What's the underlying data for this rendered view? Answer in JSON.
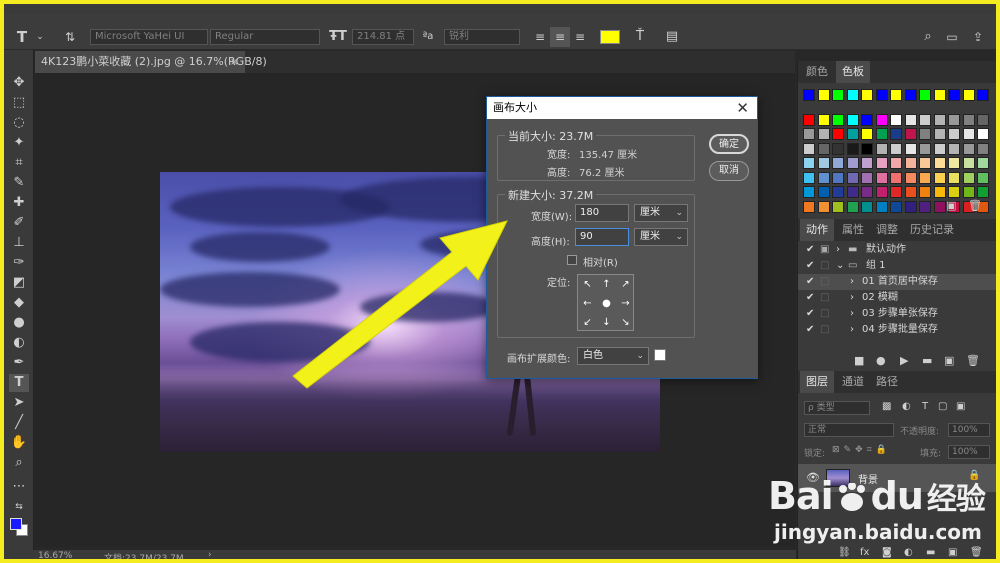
{
  "options_bar": {
    "font_family": "Microsoft YaHei UI",
    "font_style": "Regular",
    "font_size": "214.81 点",
    "aa_label": "ªa",
    "antialias": "锐利",
    "text_color": "#ffff00"
  },
  "document": {
    "tab_label": "4K123鹏小菜收藏 (2).jpg @ 16.7%(RGB/8)",
    "close_glyph": "×"
  },
  "status": {
    "zoom": "16.67%",
    "doc_info": "文档:23.7M/23.7M",
    "chevron": "›"
  },
  "dialog": {
    "title": "画布大小",
    "current_size_label": "当前大小: 23.7M",
    "current_width_label": "宽度:",
    "current_width_value": "135.47 厘米",
    "current_height_label": "高度:",
    "current_height_value": "76.2 厘米",
    "new_size_label": "新建大小: 37.2M",
    "width_label": "宽度(W):",
    "width_value": "180",
    "width_unit": "厘米",
    "height_label": "高度(H):",
    "height_value": "90",
    "height_unit": "厘米",
    "relative_label": "相对(R)",
    "anchor_label": "定位:",
    "extension_color_label": "画布扩展颜色:",
    "extension_color_value": "白色",
    "ok_button": "确定",
    "cancel_button": "取消"
  },
  "swatches_panel": {
    "tabs": [
      "颜色",
      "色板"
    ],
    "colors": [
      "#0000ff",
      "#ffff00",
      "#00ff00",
      "#00ffff",
      "#ffff00",
      "#0000ff",
      "#ffff00",
      "#0000ff",
      "#00ff00",
      "#ffff00",
      "#0000ff",
      "#ffff00",
      "#0000ff",
      "#ff0000",
      "#ffff00",
      "#00ff00",
      "#00ffff",
      "#0000ff",
      "#ff00ff",
      "#ffffff",
      "#e6e6e6",
      "#cccccc",
      "#b3b3b3",
      "#999999",
      "#808080",
      "#666666",
      "#999999",
      "#b3b3b3",
      "#ff0000",
      "#00a0a0",
      "#ffff00",
      "#00a050",
      "#1a3c8c",
      "#c0144c",
      "#808080",
      "#b3b3b3",
      "#cccccc",
      "#e6e6e6",
      "#ffffff",
      "#cccccc",
      "#666666",
      "#333333",
      "#1a1a1a",
      "#000000",
      "#b3b3b3",
      "#cccccc",
      "#e6e6e6",
      "#999999",
      "#cccccc",
      "#b3b3b3",
      "#999999",
      "#808080",
      "#8cd3f0",
      "#a0c8e0",
      "#90a8d8",
      "#a09cd0",
      "#c0a0d0",
      "#e8a0c0",
      "#f0a8a8",
      "#f4b49c",
      "#f8c896",
      "#fcdc96",
      "#f0e8a0",
      "#c8e0a0",
      "#a0d8a0",
      "#40c0f0",
      "#6090d0",
      "#5078c0",
      "#7068b0",
      "#a070b0",
      "#e070a0",
      "#f07070",
      "#f48a60",
      "#f8a850",
      "#fcd050",
      "#e8e060",
      "#a0d060",
      "#60c060",
      "#0098d8",
      "#0060b0",
      "#203c98",
      "#402c88",
      "#782c88",
      "#c0206c",
      "#e02828",
      "#e85020",
      "#f08010",
      "#f8b808",
      "#d8d010",
      "#70b818",
      "#10a030",
      "#f07820",
      "#f09030",
      "#a0c020",
      "#20a050",
      "#009090",
      "#0080c0",
      "#104898",
      "#302080",
      "#502080",
      "#901060",
      "#c01040",
      "#d82020",
      "#e05810"
    ],
    "footer_icons": [
      "new-swatch-icon",
      "trash-icon"
    ]
  },
  "actions_panel": {
    "tabs": [
      "动作",
      "属性",
      "调整",
      "历史记录"
    ],
    "rows": [
      {
        "check": "✔",
        "label": "默认动作",
        "expand": "›",
        "type": "set"
      },
      {
        "check": "✔",
        "label": "组 1",
        "expand": "⌄",
        "type": "set"
      },
      {
        "check": "✔",
        "label": "01 首页居中保存",
        "expand": "›",
        "type": "action",
        "selected": true
      },
      {
        "check": "✔",
        "label": "02 模糊",
        "expand": "›",
        "type": "action"
      },
      {
        "check": "✔",
        "label": "03 步骤单张保存",
        "expand": "›",
        "type": "action"
      },
      {
        "check": "✔",
        "label": "04 步骤批量保存",
        "expand": "›",
        "type": "action"
      }
    ],
    "controls": [
      "■",
      "●",
      "▶",
      "▬",
      "▣",
      "🗑"
    ]
  },
  "layers_panel": {
    "tabs": [
      "图层",
      "通道",
      "路径"
    ],
    "filter_label": "ρ 类型",
    "blend_mode": "正常",
    "opacity_label": "不透明度:",
    "opacity_value": "100%",
    "lock_label": "锁定:",
    "fill_label": "填充:",
    "fill_value": "100%",
    "layer_name": "背景",
    "footer_icons": [
      "link-icon",
      "fx-icon",
      "mask-icon",
      "adjustment-icon",
      "group-icon",
      "new-layer-icon",
      "trash-icon"
    ]
  },
  "watermark": {
    "brand": "Bai",
    "brand_du": "du",
    "brand_cn": "经验",
    "url": "jingyan.baidu.com"
  },
  "colors": {
    "frame_border": "#f4ec1e",
    "arrow": "#f2f21a",
    "dialog_border": "#1d5a9e"
  }
}
